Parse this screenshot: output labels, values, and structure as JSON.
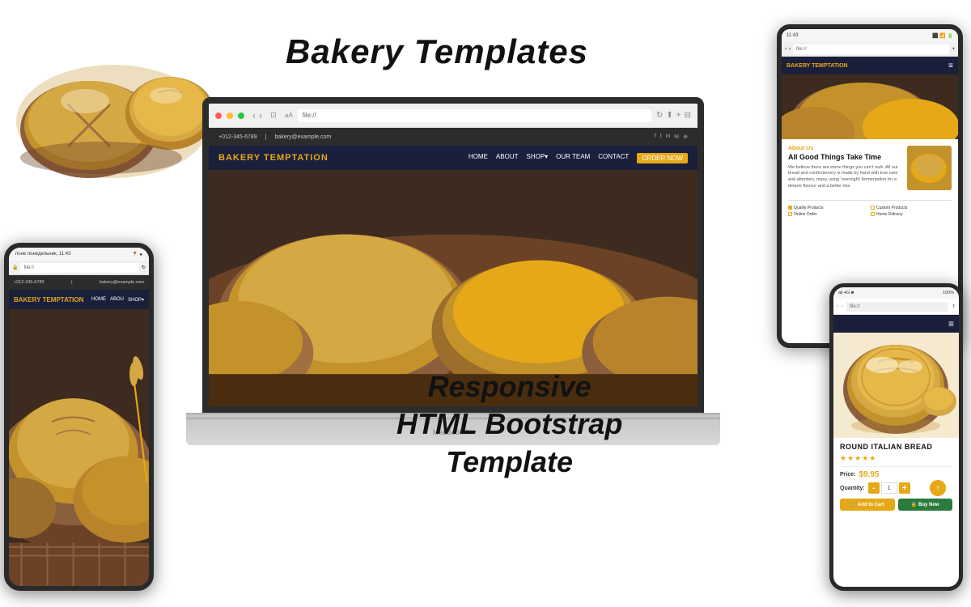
{
  "title": {
    "main": "Bakery Templates",
    "sub_line1": "Responsive",
    "sub_line2": "HTML Bootstrap",
    "sub_line3": "Template"
  },
  "macbook": {
    "model_label": "MacBook Air",
    "url": "file://",
    "topbar": {
      "phone": "+012-345-6789",
      "email": "bakery@example.com",
      "social": [
        "f",
        "t",
        "in",
        "✉",
        "⊕"
      ]
    },
    "navbar": {
      "brand": "BAKERY TEMPTATION",
      "links": [
        "HOME",
        "ABOUT",
        "SHOP▾",
        "OUR TEAM",
        "CONTACT",
        "ORDER NOW"
      ]
    }
  },
  "tablet_right": {
    "status_time": "11:43",
    "url": "file://",
    "navbar_brand": "BAKERY TEMPTATION",
    "about_label": "About Us",
    "about_heading": "All Good Things Take Time",
    "about_text": "We believe there are some things you can't rush. All our bread and confectionery is made by hand with true care and attention, many using 'overnight' fermentation for a deeper flavour and a better rise.",
    "checklist": [
      "Quality Products",
      "Custom Products",
      "Online Order",
      "Home Delivery"
    ]
  },
  "phone_left": {
    "status_time": "поне понедельник, 11:43",
    "url": "file://",
    "phone": "+012-345-6789",
    "email": "bakery@example.com",
    "navbar_brand": "BAKERY TEMPTATION",
    "nav_links": [
      "HOME",
      "ABOU",
      "SHOP▾"
    ]
  },
  "phone_right": {
    "status_right": "100%",
    "product_name": "ROUND ITALIAN BREAD",
    "stars": "★★★★★",
    "price_label": "Price:",
    "price_value": "$9.95",
    "quantity_label": "Quantity:",
    "quantity_value": "1",
    "add_to_cart_label": "🛒 Add to Cart",
    "buy_now_label": "🔒 Buy Now",
    "qty_minus": "-",
    "qty_plus": "+"
  },
  "colors": {
    "brand_gold": "#e6a817",
    "navy": "#1a1f3c",
    "dark": "#2c2c2c",
    "white": "#ffffff",
    "text_dark": "#111111",
    "price_gold": "#e6a817",
    "buy_green": "#2c7a3c"
  }
}
